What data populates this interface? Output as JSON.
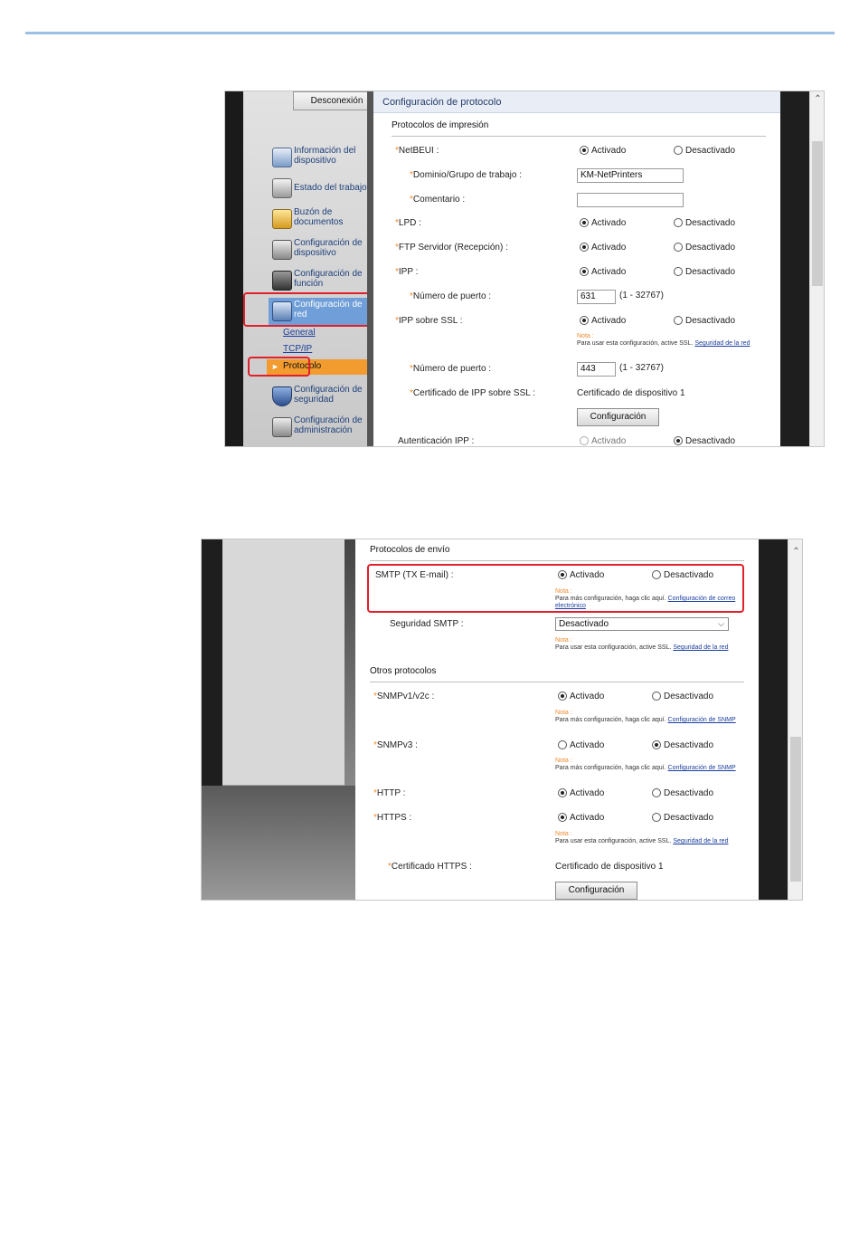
{
  "screen1": {
    "sidebar": {
      "logout_label": "Desconexión",
      "items": [
        {
          "label": "Información del dispositivo",
          "icon": "device-info-icon"
        },
        {
          "label": "Estado del trabajo",
          "icon": "job-status-icon"
        },
        {
          "label": "Buzón de documentos",
          "icon": "document-box-icon"
        },
        {
          "label": "Configuración de dispositivo",
          "icon": "device-settings-icon"
        },
        {
          "label": "Configuración de función",
          "icon": "function-settings-icon"
        },
        {
          "label": "Configuración de red",
          "icon": "network-settings-icon"
        },
        {
          "label": "Configuración de seguridad",
          "icon": "security-shield-icon"
        },
        {
          "label": "Configuración de administración",
          "icon": "admin-settings-icon"
        }
      ],
      "subitems": {
        "general": "General",
        "tcpip": "TCP/IP",
        "protocolo": "Protocolo"
      }
    },
    "content": {
      "title": "Configuración de protocolo",
      "section": "Protocolos de impresión",
      "on": "Activado",
      "off": "Desactivado",
      "netbeui": "NetBEUI :",
      "workgroup_label": "Dominio/Grupo de trabajo :",
      "workgroup_value": "KM-NetPrinters",
      "comment_label": "Comentario :",
      "comment_value": "",
      "lpd": "LPD :",
      "ftp": "FTP Servidor (Recepción) :",
      "ipp": "IPP :",
      "port_label": "Número de puerto :",
      "ipp_port": "631",
      "port_range": "(1 - 32767)",
      "ipp_ssl": "IPP sobre SSL :",
      "note_label": "Nota :",
      "ssl_note_text": "Para usar esta configuración, active SSL.",
      "ssl_note_link": "Seguridad de la red",
      "ssl_port": "443",
      "cert_label": "Certificado de IPP sobre SSL :",
      "cert_value": "Certificado de dispositivo 1",
      "config_button": "Configuración",
      "ipp_auth": "Autenticación IPP :"
    }
  },
  "screen2": {
    "section_send": "Protocolos de envío",
    "smtp": "SMTP (TX E-mail) :",
    "on": "Activado",
    "off": "Desactivado",
    "note_label": "Nota :",
    "more_config_text": "Para más configuración, haga clic aquí.",
    "email_link": "Configuración de correo electrónico",
    "smtp_security_label": "Seguridad SMTP :",
    "smtp_security_value": "Desactivado",
    "ssl_note_text": "Para usar esta configuración, active SSL.",
    "ssl_link": "Seguridad de la red",
    "section_other": "Otros protocolos",
    "snmpv1": "SNMPv1/v2c :",
    "snmp_link": "Configuración de SNMP",
    "snmpv3": "SNMPv3 :",
    "http": "HTTP :",
    "https": "HTTPS :",
    "https_cert_label": "Certificado HTTPS :",
    "https_cert_value": "Certificado de dispositivo 1",
    "config_button": "Configuración"
  }
}
